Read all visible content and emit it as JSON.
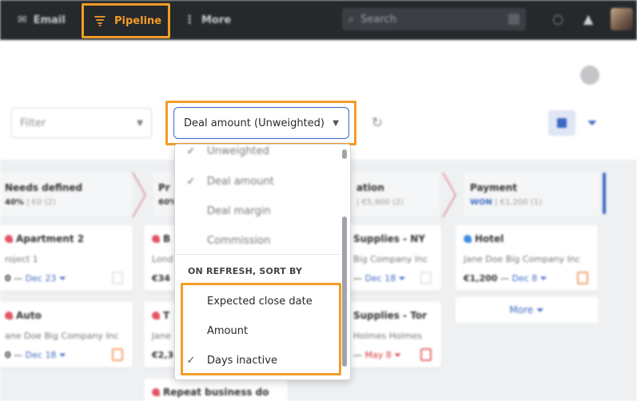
{
  "topbar": {
    "nav_email": "Email",
    "nav_pipeline": "Pipeline",
    "nav_more": "More",
    "search_placeholder": "Search"
  },
  "toolbar": {
    "filter_label": "Filter",
    "sum_by_label": "Deal amount (Unweighted)"
  },
  "dropdown": {
    "partial_top_item": "Unweighted",
    "value_items": [
      {
        "label": "Deal amount",
        "checked": true
      },
      {
        "label": "Deal margin",
        "checked": false
      },
      {
        "label": "Commission",
        "checked": false
      }
    ],
    "sort_heading": "ON REFRESH, SORT BY",
    "sort_items": [
      {
        "label": "Expected close date",
        "checked": false
      },
      {
        "label": "Amount",
        "checked": false
      },
      {
        "label": "Days inactive",
        "checked": true
      }
    ]
  },
  "stages": [
    {
      "title": "Needs defined",
      "pct": "40%",
      "amount": "€0 (2)"
    },
    {
      "title": "Pr",
      "pct": "60%",
      "amount": ""
    },
    {
      "title": "ation",
      "pct": "",
      "amount": "€5,900 (2)"
    },
    {
      "title": "Payment",
      "pct": "WON",
      "amount": "€1,200 (1)"
    }
  ],
  "cards": [
    {
      "title": "Apartment 2",
      "sub": "roject 1",
      "value": "0",
      "date": "Dec 23",
      "dot": "#e25563"
    },
    {
      "title": "Auto",
      "sub": "ane Doe Big Company Inc",
      "value": "0",
      "date": "Dec 18",
      "dot": "#e25563"
    },
    {
      "title": "B",
      "sub": "Lond",
      "value": "€34",
      "date": "",
      "dot": "#e25563"
    },
    {
      "title": "T",
      "sub": "Jane",
      "value": "€2,3",
      "date": "",
      "dot": "#e25563"
    },
    {
      "title": "Supplies - NY",
      "sub": "Big Company Inc",
      "value": "",
      "date": "Dec 18",
      "dot": "#e25563"
    },
    {
      "title": "Supplies - Tor",
      "sub": "Holmes Holmes",
      "value": "",
      "date": "May 8",
      "dot": "#e25563"
    },
    {
      "title": "Hotel",
      "sub": "Jane Doe Big Company Inc",
      "value": "€1,200",
      "date": "Dec 8",
      "dot": "#3d8de0"
    },
    {
      "title": "Repeat business do",
      "sub": "",
      "value": "",
      "date": "",
      "dot": "#e25563"
    }
  ],
  "more_label": "More",
  "colors": {
    "accent": "#f39c27",
    "brand": "#3d68c4",
    "topbar": "#26292c"
  }
}
